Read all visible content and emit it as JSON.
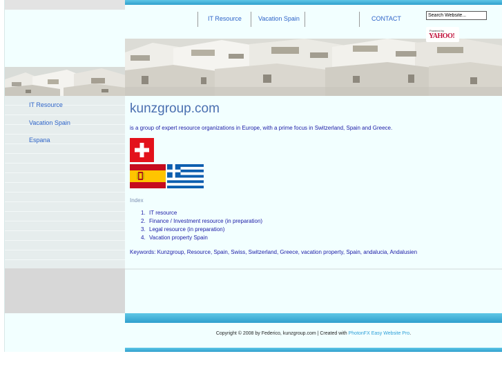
{
  "nav": {
    "links": [
      {
        "label": "IT Resource"
      },
      {
        "label": "Vacation Spain"
      },
      {
        "label": "CONTACT"
      }
    ],
    "search_value": "Search Website...",
    "yahoo_powered": "Powered by",
    "yahoo_logo": "YAHOO!"
  },
  "sidebar": {
    "items": [
      {
        "label": "IT Resource"
      },
      {
        "label": "Vacation Spain"
      },
      {
        "label": "Espana"
      }
    ]
  },
  "main": {
    "title": "kunzgroup.com",
    "intro": "is a group of expert resource organizations in Europe, with a prime focus in Switzerland, Spain and Greece.",
    "flags": [
      "switzerland-flag",
      "spain-flag",
      "greece-flag"
    ],
    "index_label": "Index",
    "index_items": [
      {
        "num": "1.",
        "label": "IT resource"
      },
      {
        "num": "2.",
        "label": "Finance / Investment resource (in preparation)"
      },
      {
        "num": "3.",
        "label": "Legal resource (in preparation)"
      },
      {
        "num": "4.",
        "label": "Vacation property Spain"
      }
    ],
    "keywords": "Keywords: Kunzgroup, Resource, Spain, Swiss, Switzerland,  Greece, vacation property, Spain, andalucia, Andalusien"
  },
  "footer": {
    "copyright": "Copyright © 2008 by Federico, kunzgroup.com | Created with ",
    "link": "PhotonFX Easy Website Pro",
    "end": "."
  },
  "colors": {
    "accent_blue": "#2f9fcd",
    "link_blue": "#2d63c8",
    "text_navy": "#1a1aa6",
    "page_bg": "#f2ffff"
  }
}
